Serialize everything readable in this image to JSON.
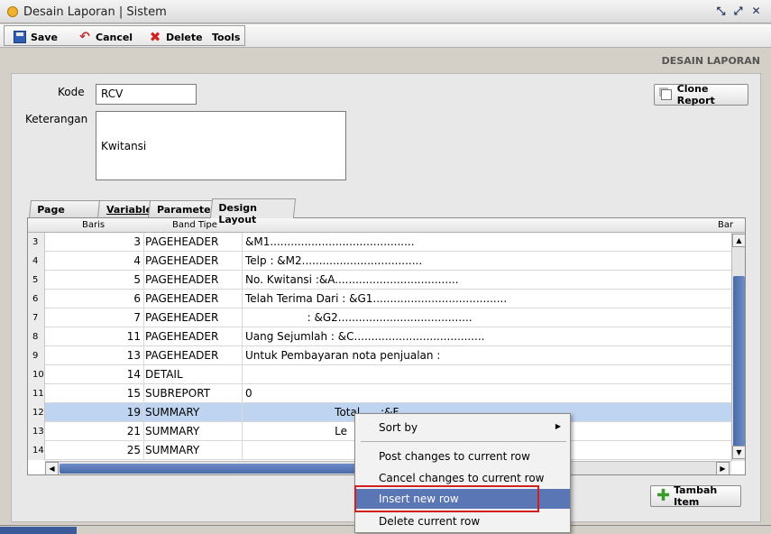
{
  "window": {
    "title": "Desain Laporan | Sistem"
  },
  "toolbar": {
    "save": "Save",
    "cancel": "Cancel",
    "delete": "Delete",
    "tools": "Tools"
  },
  "page_title": "DESAIN LAPORAN",
  "form": {
    "kode_label": "Kode",
    "kode_value": "RCV",
    "keterangan_label": "Keterangan",
    "keterangan_value": "Kwitansi",
    "clone_button": "Clone Report"
  },
  "tabs": [
    "Page Setup",
    "Variable",
    "Parameter",
    "Design Layout"
  ],
  "grid": {
    "headers": {
      "baris": "Baris",
      "band": "Band Tipe",
      "bar": "Bar"
    },
    "rows": [
      {
        "idx": "3",
        "baris": "3",
        "band": "PAGEHEADER",
        "text": "&M1.........................................."
      },
      {
        "idx": "4",
        "baris": "4",
        "band": "PAGEHEADER",
        "text": "Telp : &M2..................................."
      },
      {
        "idx": "5",
        "baris": "5",
        "band": "PAGEHEADER",
        "text": "No. Kwitansi :&A...................................."
      },
      {
        "idx": "6",
        "baris": "6",
        "band": "PAGEHEADER",
        "text": "Telah Terima Dari : &G1......................................."
      },
      {
        "idx": "7",
        "baris": "7",
        "band": "PAGEHEADER",
        "text": "                  : &G2......................................."
      },
      {
        "idx": "8",
        "baris": "11",
        "band": "PAGEHEADER",
        "text": "Uang Sejumlah : &C......................................"
      },
      {
        "idx": "9",
        "baris": "13",
        "band": "PAGEHEADER",
        "text": "Untuk Pembayaran nota penjualan :"
      },
      {
        "idx": "10",
        "baris": "14",
        "band": "DETAIL",
        "text": ""
      },
      {
        "idx": "11",
        "baris": "15",
        "band": "SUBREPORT",
        "text": "0"
      },
      {
        "idx": "12",
        "baris": "19",
        "band": "SUMMARY",
        "text": "                          Total      :&F"
      },
      {
        "idx": "13",
        "baris": "21",
        "band": "SUMMARY",
        "text": "                          Le"
      },
      {
        "idx": "14",
        "baris": "25",
        "band": "SUMMARY",
        "text": ""
      }
    ],
    "selected_index": 9
  },
  "add_button": "Tambah Item",
  "context_menu": {
    "sort_by": "Sort by",
    "post": "Post changes to current row",
    "cancel": "Cancel changes to current row",
    "insert": "Insert new row",
    "delete": "Delete current row"
  },
  "colors": {
    "selection": "#bfd4f0",
    "menu_highlight": "#5b76b5",
    "annotation": "#d02020"
  }
}
